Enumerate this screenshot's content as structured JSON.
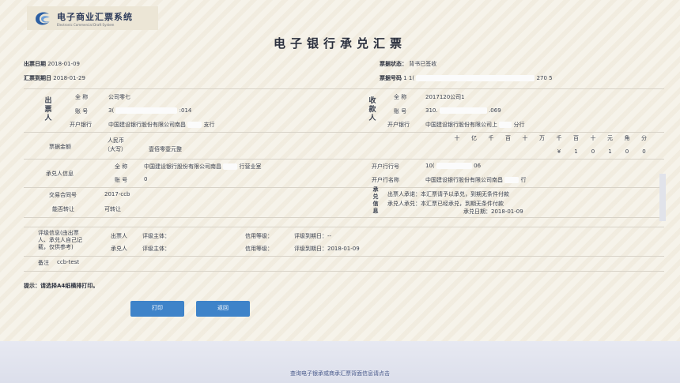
{
  "logo": {
    "cn": "电子商业汇票系统",
    "en": "Electronic Commercial Draft System"
  },
  "title": "电子银行承兑汇票",
  "header": {
    "issue_label": "出票日期",
    "issue_value": "2018-01-09",
    "due_label": "汇票到期日",
    "due_value": "2018-01-29",
    "status_label": "票据状态：",
    "status_value": "背书已签收",
    "number_label": "票据号码",
    "number_prefix": "1 1(",
    "number_suffix": "270 5"
  },
  "drawer": {
    "side_label": "出票人",
    "name_label": "全 称",
    "name_value": "公司零七",
    "acct_label": "账 号",
    "acct_prefix": "3(",
    "acct_suffix": ":014",
    "bank_label": "开户银行",
    "bank_value": "中国建设银行股份有限公司南昌",
    "bank_suffix": "支行"
  },
  "payee": {
    "side_label": "收款人",
    "name_label": "全 称",
    "name_value": "2017120公司1",
    "acct_label": "账 号",
    "acct_prefix": "310.",
    "acct_suffix": ".069",
    "bank_label": "开户银行",
    "bank_value": "中国建设银行股份有限公司上",
    "bank_suffix": "分行"
  },
  "amount": {
    "label": "票据金额",
    "currency": "人民币",
    "upper_note": "（大写）",
    "upper_value": "壹佰零壹元整",
    "units": [
      "十",
      "亿",
      "千",
      "百",
      "十",
      "万",
      "千",
      "百",
      "十",
      "元",
      "角",
      "分"
    ],
    "digits": [
      "",
      "",
      "",
      "",
      "",
      "",
      "¥",
      "1",
      "0",
      "1",
      "0",
      "0"
    ]
  },
  "acceptor": {
    "label": "承兑人信息",
    "name_label": "全 称",
    "name_value": "中国建设银行股份有限公司南昌",
    "name_suffix": "行营业室",
    "acct_label": "账 号",
    "acct_value": "0",
    "bankno_label": "开户行行号",
    "bankno_prefix": "10(",
    "bankno_suffix": "06",
    "bankname_label": "开户行名称",
    "bankname_value": "中国建设银行股份有限公司南昌",
    "bankname_suffix": "行"
  },
  "contract": {
    "label": "交易合同号",
    "value": "2017-ccb"
  },
  "transfer": {
    "label": "能否转让",
    "value": "可转让"
  },
  "accept_info": {
    "side_label": "承兑信息",
    "line1": "出票人承诺：本汇票请予以承兑，到期无条件付款",
    "line2": "承兑人承兑：本汇票已经承兑，到期无条件付款",
    "line3": "承兑日期：2018-01-09"
  },
  "credit": {
    "label": "评级信息(由出票人、承兑人自己记载，仅供参考)",
    "r1_role": "出票人",
    "r1_subject": "评级主体：",
    "r1_grade": "信用等级：",
    "r1_due": "评级到期日：--",
    "r2_role": "承兑人",
    "r2_subject": "评级主体：",
    "r2_grade": "信用等级：",
    "r2_due": "评级到期日：2018-01-09"
  },
  "remark": {
    "label": "备注",
    "value": "ccb-test"
  },
  "hint": "提示：请选择A4纸横排打印。",
  "buttons": {
    "print": "打印",
    "back": "返回"
  },
  "footer": "查询电子银承或商承汇票背面信息请点击",
  "colors": {
    "button": "#3e83c9",
    "paper": "#f6f3ea",
    "grid": "#d8d3c8"
  }
}
